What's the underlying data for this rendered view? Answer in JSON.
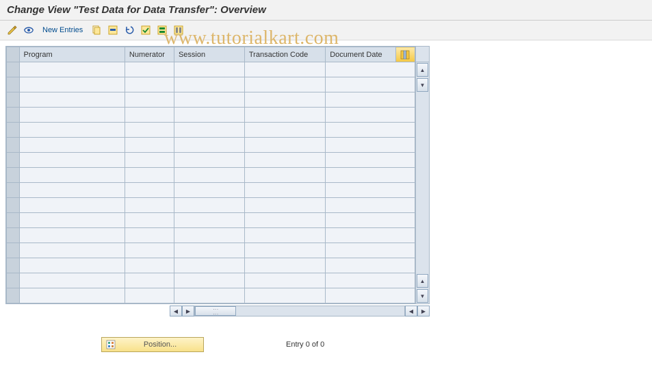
{
  "title": "Change View \"Test Data for Data Transfer\": Overview",
  "watermark": "www.tutorialkart.com",
  "toolbar": {
    "new_entries": "New Entries"
  },
  "table": {
    "columns": {
      "program": "Program",
      "numerator": "Numerator",
      "session": "Session",
      "transaction_code": "Transaction Code",
      "document_date": "Document Date"
    },
    "row_count": 16
  },
  "footer": {
    "position_label": "Position...",
    "entry_text": "Entry 0 of 0"
  }
}
